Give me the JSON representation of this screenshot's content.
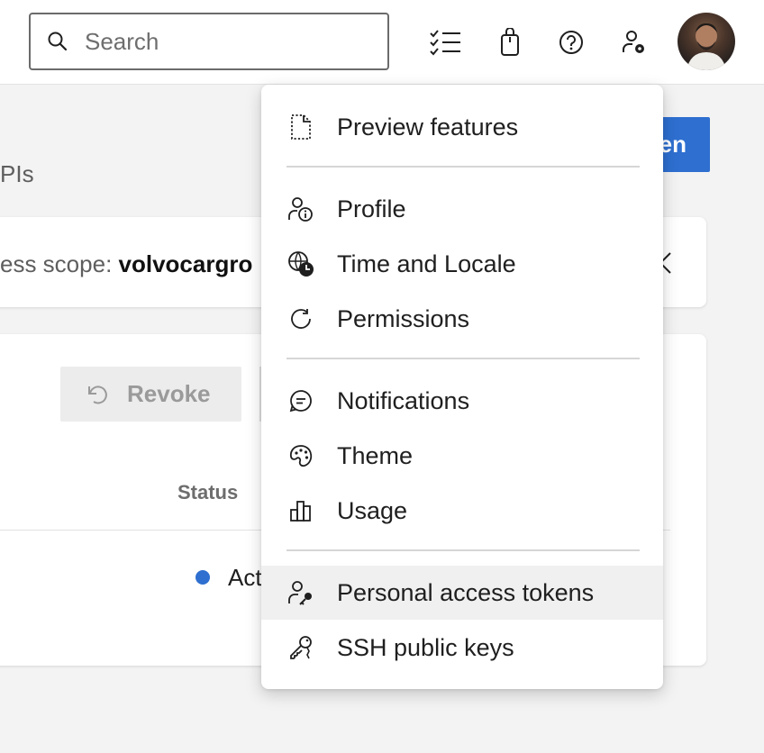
{
  "search": {
    "placeholder": "Search"
  },
  "topbar": {
    "icons": [
      "task-list-icon",
      "bag-icon",
      "help-icon",
      "user-settings-icon"
    ],
    "avatar_alt": ""
  },
  "page": {
    "primary_button_partial": "en",
    "subtitle_partial": "PIs",
    "scope_label_partial": "ess scope: ",
    "scope_value_partial": "volvocargro",
    "revoke_label": "Revoke",
    "status_header": "Status",
    "status_value_partial": "Act",
    "status_color": "#2e6fd0"
  },
  "menu": {
    "groups": [
      [
        {
          "label": "Preview features",
          "icon": "preview-features-icon"
        }
      ],
      [
        {
          "label": "Profile",
          "icon": "profile-icon"
        },
        {
          "label": "Time and Locale",
          "icon": "globe-clock-icon"
        },
        {
          "label": "Permissions",
          "icon": "permissions-icon"
        }
      ],
      [
        {
          "label": "Notifications",
          "icon": "notifications-icon"
        },
        {
          "label": "Theme",
          "icon": "palette-icon"
        },
        {
          "label": "Usage",
          "icon": "usage-icon"
        }
      ],
      [
        {
          "label": "Personal access tokens",
          "icon": "personal-access-token-icon",
          "active": true
        },
        {
          "label": "SSH public keys",
          "icon": "ssh-key-icon"
        }
      ]
    ]
  },
  "colors": {
    "accent": "#2e6fd0",
    "menu_active_bg": "#f0f0f0"
  }
}
